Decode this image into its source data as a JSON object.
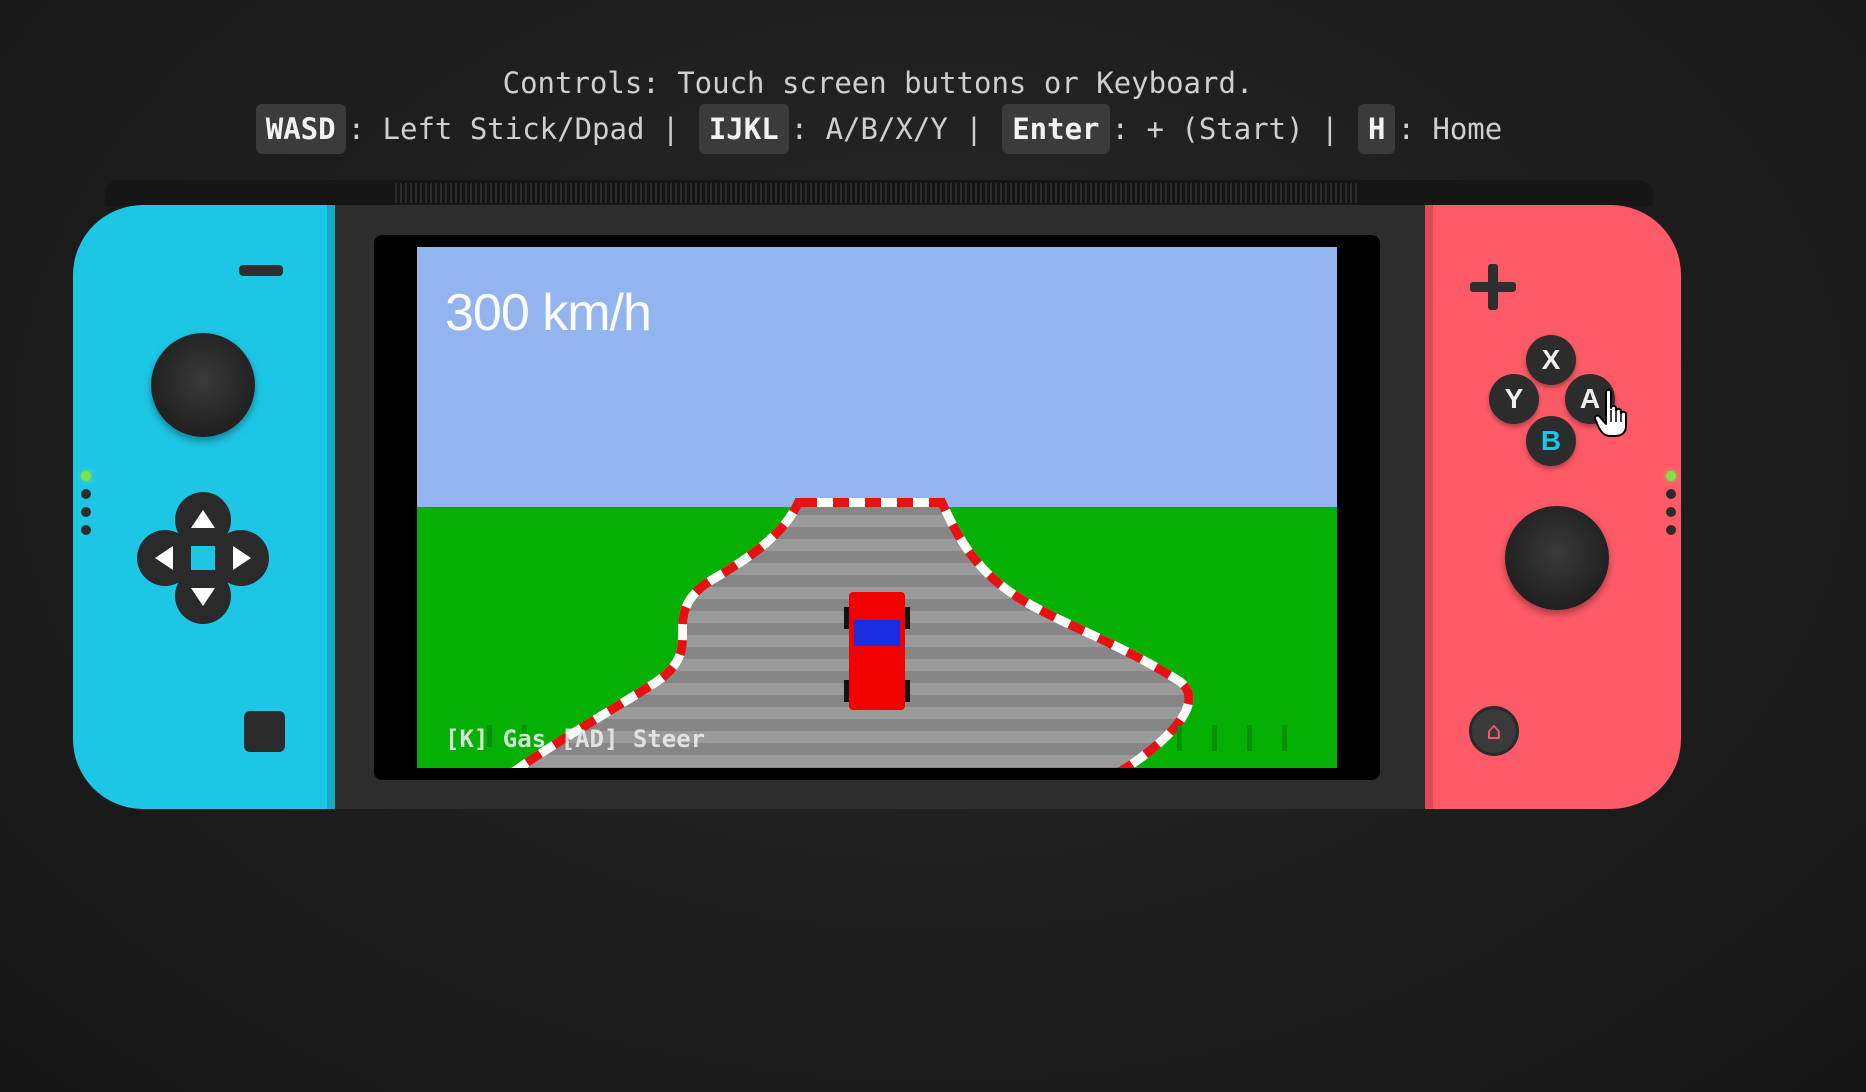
{
  "instructions": {
    "title": "Controls: Touch screen buttons or Keyboard.",
    "bindings": [
      {
        "key": "WASD",
        "desc": ": Left Stick/Dpad"
      },
      {
        "key": "IJKL",
        "desc": ": A/B/X/Y"
      },
      {
        "key": "Enter",
        "desc": ": + (Start)"
      },
      {
        "key": "H",
        "desc": ": Home"
      }
    ],
    "separator": "|"
  },
  "game": {
    "speed_text": "300 km/h",
    "hud_text": "[K] Gas [AD] Steer",
    "colors": {
      "sky": "#93b4ee",
      "grass": "#05b005",
      "road": "#868686",
      "road_stripe": "#9a9a9a",
      "curb_red": "#e81010",
      "curb_white": "#ffffff",
      "car_body": "#f20000",
      "car_window": "#1a2de0"
    }
  },
  "console": {
    "colors": {
      "left_joycon": "#1ec6e6",
      "right_joycon": "#ff5a67",
      "body": "#2d2d2d",
      "led": "#7fe24a"
    },
    "left": {
      "minus_icon": "minus-icon",
      "capture_icon": "capture-icon"
    },
    "right": {
      "plus_icon": "plus-icon",
      "home_icon": "⌂",
      "buttons": {
        "x": "X",
        "y": "Y",
        "a": "A",
        "b": "B"
      }
    }
  }
}
